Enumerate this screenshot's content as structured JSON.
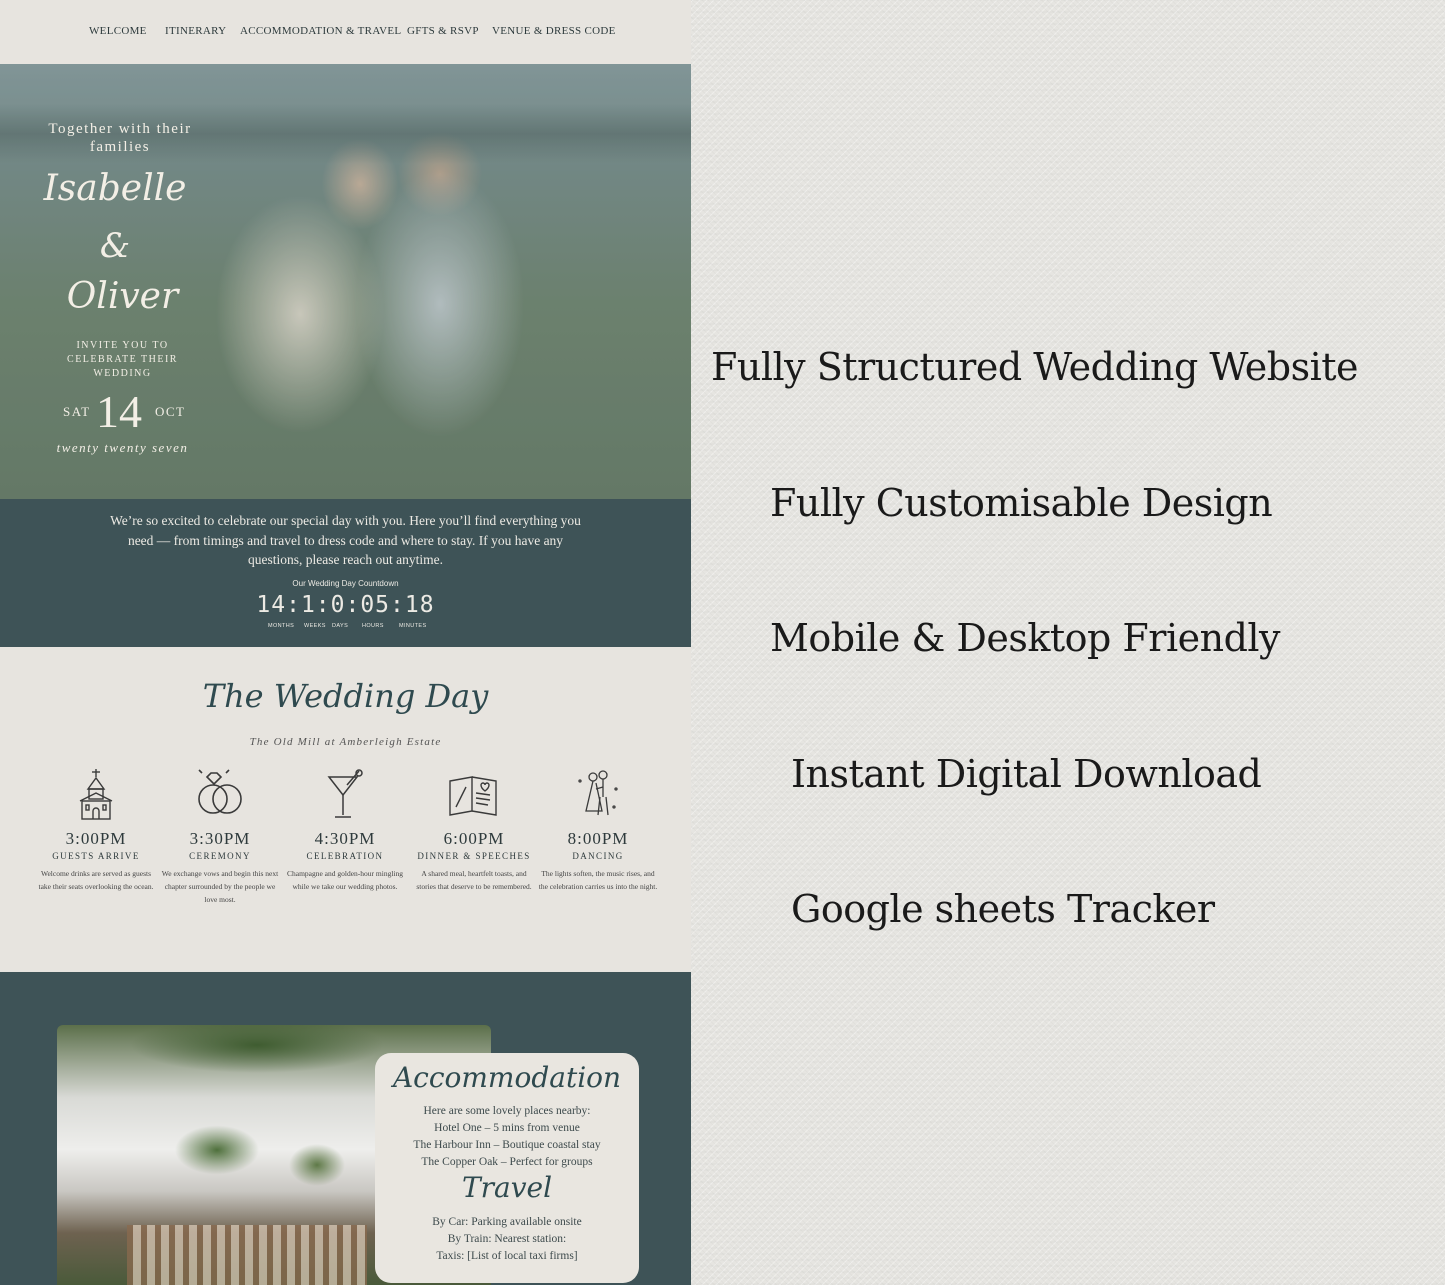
{
  "nav": [
    "WELCOME",
    "ITINERARY",
    "ACCOMMODATION & TRAVEL",
    "GFTS & RSVP",
    "VENUE & DRESS CODE"
  ],
  "hero": {
    "together": "Together with their families",
    "name1": "Isabelle",
    "amp": "&",
    "name2": "Oliver",
    "invite": "INVITE YOU TO CELEBRATE THEIR WEDDING",
    "weekday": "SAT",
    "day": "14",
    "month": "OCT",
    "year": "twenty twenty seven"
  },
  "intro": {
    "message": "We’re so excited to celebrate our special day with you. Here you’ll find everything you need — from timings and travel to dress code and where to stay. If you have any questions, please reach out anytime.",
    "countdown_title": "Our Wedding Day Countdown",
    "countdown_value": "14:1:0:05:18",
    "countdown_labels": [
      "MONTHS",
      "WEEKS",
      "DAYS",
      "HOURS",
      "MINUTES"
    ]
  },
  "wedding_day": {
    "title": "The Wedding Day",
    "venue": "The Old Mill at Amberleigh Estate",
    "events": [
      {
        "icon": "chapel-icon",
        "time": "3:00PM",
        "label": "GUESTS ARRIVE",
        "desc": "Welcome drinks are served as guests take their seats overlooking the ocean."
      },
      {
        "icon": "rings-icon",
        "time": "3:30PM",
        "label": "CEREMONY",
        "desc": "We exchange vows and begin this next chapter surrounded by the people we love most."
      },
      {
        "icon": "cocktail-icon",
        "time": "4:30PM",
        "label": "CELEBRATION",
        "desc": "Champagne and golden-hour mingling while we take our wedding photos."
      },
      {
        "icon": "menu-book-icon",
        "time": "6:00PM",
        "label": "DINNER & SPEECHES",
        "desc": "A shared meal, heartfelt toasts, and stories that deserve to be remembered."
      },
      {
        "icon": "dancing-couple-icon",
        "time": "8:00PM",
        "label": "DANCING",
        "desc": "The lights soften, the music rises, and the celebration carries us into the night."
      }
    ]
  },
  "accommodation": {
    "title": "Accommodation",
    "lines": [
      "Here are some lovely places nearby:",
      "Hotel One – 5 mins from venue",
      "The Harbour Inn – Boutique coastal stay",
      "The Copper Oak – Perfect for groups"
    ],
    "travel_title": "Travel",
    "travel_lines": [
      "By Car: Parking available onsite",
      "By Train: Nearest station:",
      "Taxis: [List of local taxi firms]"
    ]
  },
  "promo": [
    "Fully Structured Wedding Website",
    "Fully Customisable Design",
    "Mobile & Desktop Friendly",
    "Instant Digital Download",
    "Google sheets Tracker"
  ],
  "colors": {
    "accent": "#3e5357",
    "paper": "#e7e4df",
    "text": "#2d3a3c"
  }
}
